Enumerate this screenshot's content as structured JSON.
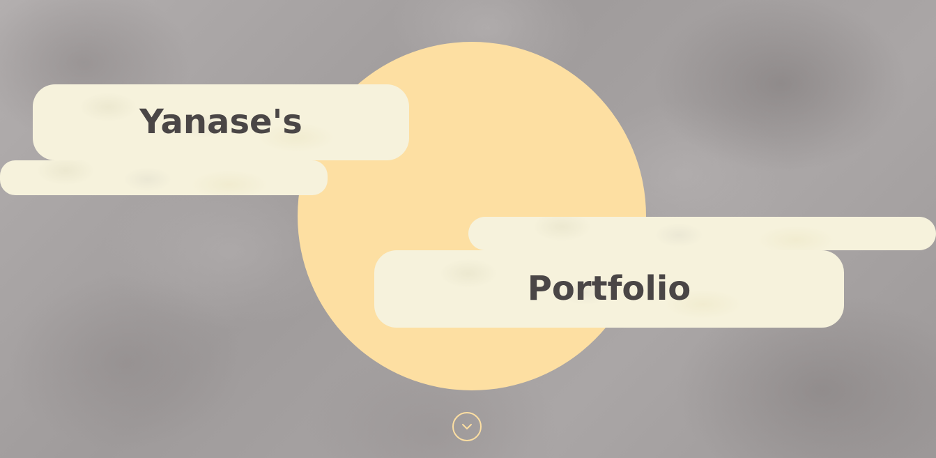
{
  "hero": {
    "title_line1": "Yanase's",
    "title_line2": "Portfolio",
    "scroll_icon": "chevron-down-icon"
  },
  "colors": {
    "moon": "#fddfa2",
    "cloud": "#f6f2dc",
    "text": "#4a4646",
    "accent": "#fddfa2",
    "background": "#a8a4a4"
  }
}
